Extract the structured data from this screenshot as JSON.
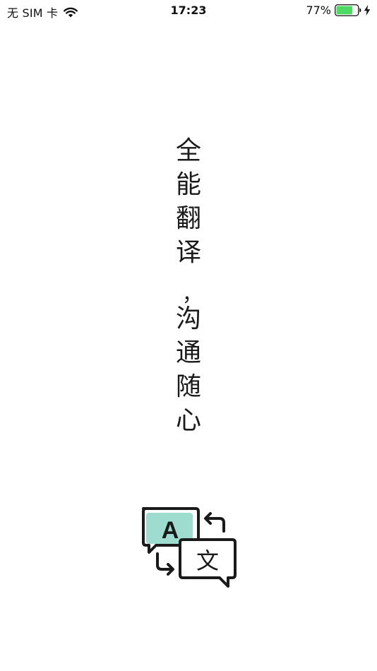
{
  "status_bar": {
    "carrier": "无 SIM 卡",
    "wifi_icon": "wifi-icon",
    "time": "17:23",
    "battery_percent_text": "77%",
    "battery_level": 0.77,
    "battery_color": "#4cd964",
    "charging_icon": "lightning-bolt-icon"
  },
  "slogan": {
    "line1": [
      "全",
      "能",
      "翻",
      "译"
    ],
    "comma": "，",
    "line2": [
      "沟",
      "通",
      "随",
      "心"
    ]
  },
  "logo": {
    "icon": "translate-icon",
    "letter_a": "A",
    "letter_wen": "文",
    "accent_color": "#9ddccf",
    "stroke_color": "#1a1a1a"
  }
}
